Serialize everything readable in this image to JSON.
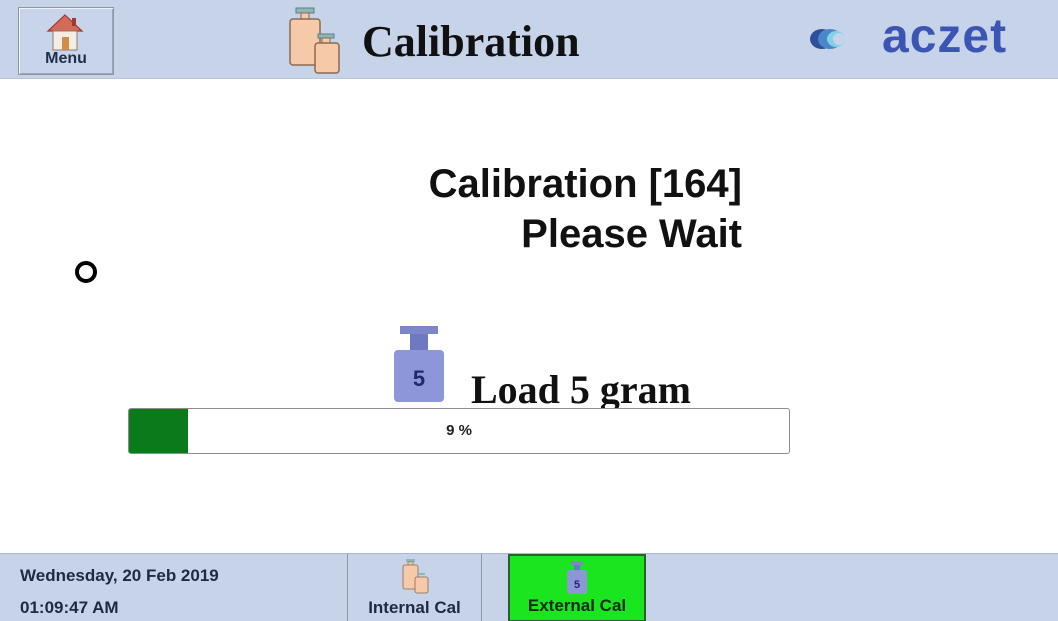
{
  "header": {
    "menu_label": "Menu",
    "title": "Calibration",
    "brand": "aczet"
  },
  "main": {
    "status_line1": "Calibration [164]",
    "status_line2": "Please Wait",
    "weight_value": "5",
    "load_instruction": "Load 5 gram",
    "progress_percent": 9,
    "progress_label": "9 %"
  },
  "footer": {
    "date": "Wednesday, 20 Feb 2019",
    "time": "01:09:47 AM",
    "tabs": [
      {
        "label": "Internal Cal",
        "active": false
      },
      {
        "label": "External Cal",
        "active": true,
        "icon_value": "5"
      }
    ]
  },
  "colors": {
    "header_bg": "#c6d3e8",
    "progress_fill": "#0a7a1a",
    "active_tab": "#19e61e",
    "brand": "#3b55b5"
  },
  "icons": {
    "menu": "home-icon",
    "title": "weights-icon",
    "brand": "aczet-logo-icon",
    "weight": "weight-5-icon",
    "activity": "busy-ring-icon"
  }
}
